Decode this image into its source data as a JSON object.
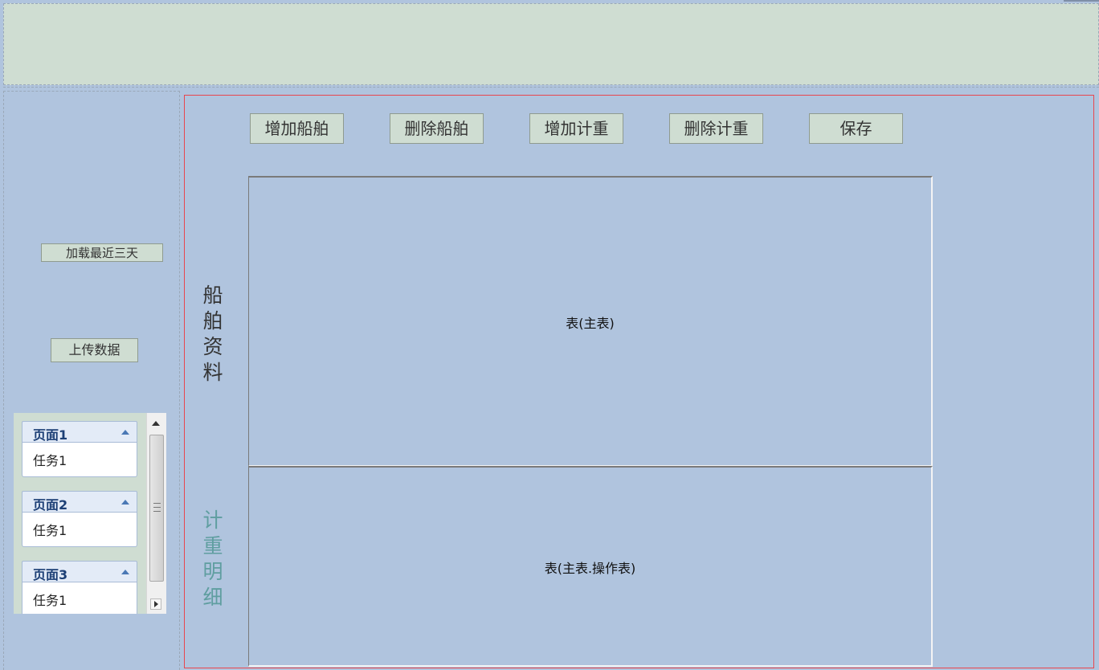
{
  "sidebar": {
    "load_recent_label": "加载最近三天",
    "upload_label": "上传数据",
    "accordion": [
      {
        "title": "页面1",
        "item": "任务1"
      },
      {
        "title": "页面2",
        "item": "任务1"
      },
      {
        "title": "页面3",
        "item": "任务1"
      }
    ]
  },
  "toolbar": {
    "add_ship_label": "增加船舶",
    "delete_ship_label": "删除船舶",
    "add_weigh_label": "增加计重",
    "delete_weigh_label": "删除计重",
    "save_label": "保存"
  },
  "sections": {
    "ship_info_label": "船舶资料",
    "weigh_detail_label": "计重明细"
  },
  "tables": {
    "main_caption": "表(主表)",
    "detail_caption": "表(主表.操作表)"
  },
  "colors": {
    "background": "#b0c4de",
    "button": "#cfddd2",
    "main_border": "#e8464e",
    "weigh_label": "#5f9ea0"
  }
}
